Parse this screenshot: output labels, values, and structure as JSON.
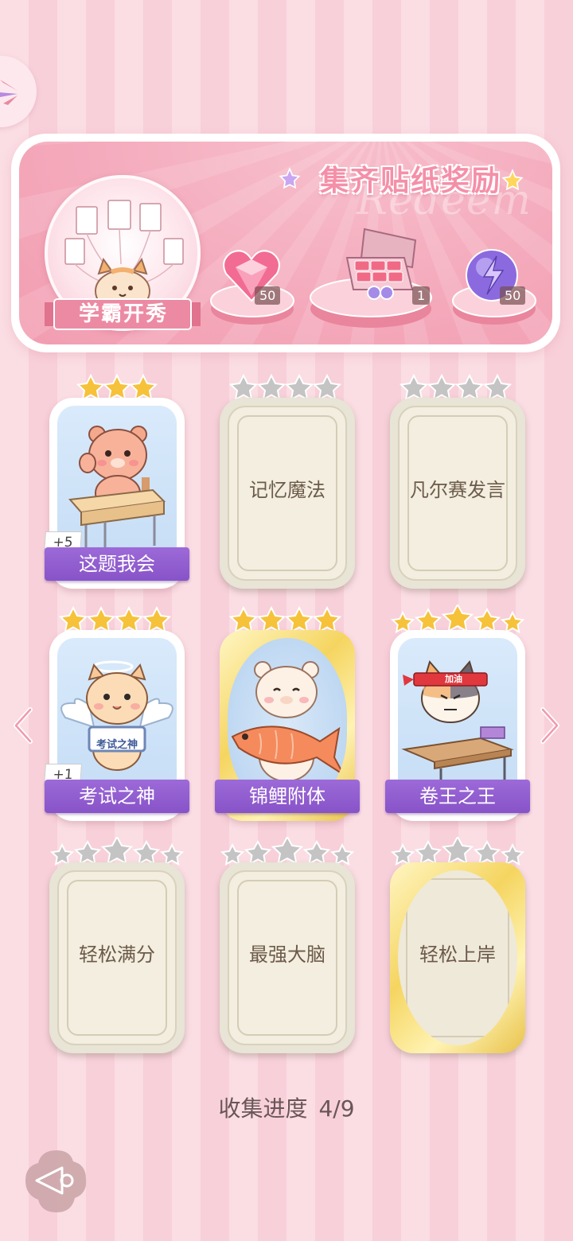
{
  "banner": {
    "title": "集齐贴纸奖励",
    "watermark": "Redeem",
    "emblem_label": "学霸开秀",
    "rewards": [
      {
        "name": "heart-gem",
        "count": "50"
      },
      {
        "name": "sticker-box",
        "count": "1"
      },
      {
        "name": "energy-orb",
        "count": "50"
      }
    ]
  },
  "cards": [
    {
      "label": "这题我会",
      "unlocked": true,
      "stars": 3,
      "bonus": "+5"
    },
    {
      "label": "记忆魔法",
      "unlocked": false,
      "stars": 4
    },
    {
      "label": "凡尔赛发言",
      "unlocked": false,
      "stars": 4
    },
    {
      "label": "考试之神",
      "unlocked": true,
      "stars": 4,
      "bonus": "+1",
      "sign_text": "考试之神"
    },
    {
      "label": "锦鲤附体",
      "unlocked": true,
      "stars": 4
    },
    {
      "label": "卷王之王",
      "unlocked": true,
      "stars": 5,
      "headband_text": "加油"
    },
    {
      "label": "轻松满分",
      "unlocked": false,
      "stars": 5
    },
    {
      "label": "最强大脑",
      "unlocked": false,
      "stars": 5
    },
    {
      "label": "轻松上岸",
      "unlocked": false,
      "stars": 5
    }
  ],
  "progress": {
    "label": "收集进度",
    "value": "4/9"
  },
  "colors": {
    "pink_bg": "#fbdde4",
    "banner_pink": "#f4a9bb",
    "purple_banner": "#8753c8",
    "gold_star": "#f6c23a",
    "grey_star": "#c4c4c4"
  }
}
